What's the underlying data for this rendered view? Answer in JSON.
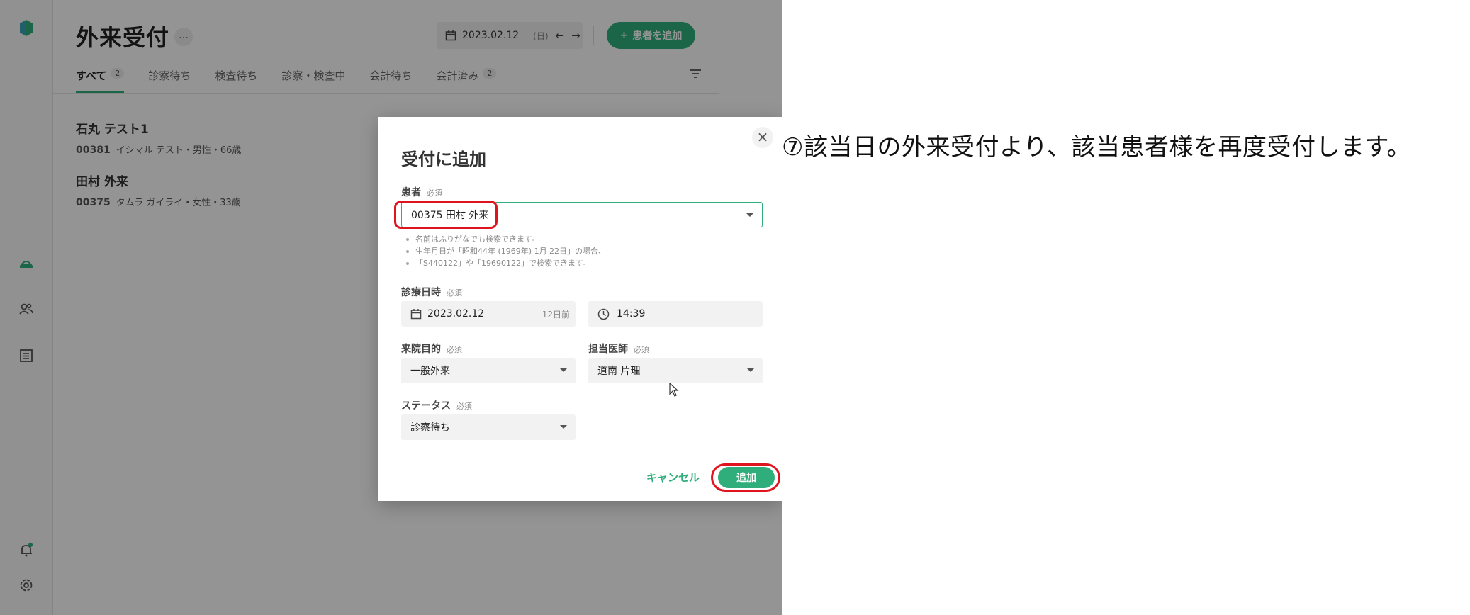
{
  "header": {
    "title": "外来受付",
    "more": "…",
    "date": "2023.02.12",
    "day_of_week": "(日)",
    "add_patient_label": "患者を追加"
  },
  "tabs": [
    {
      "label": "すべて",
      "badge": "2"
    },
    {
      "label": "診察待ち",
      "badge": ""
    },
    {
      "label": "検査待ち",
      "badge": ""
    },
    {
      "label": "診察・検査中",
      "badge": ""
    },
    {
      "label": "会計待ち",
      "badge": ""
    },
    {
      "label": "会計済み",
      "badge": "2"
    }
  ],
  "patients": [
    {
      "name": "石丸 テスト1",
      "id": "00381",
      "details": "イシマル テスト・男性・66歳"
    },
    {
      "name": "田村 外来",
      "id": "00375",
      "details": "タムラ ガイライ・女性・33歳"
    }
  ],
  "dialog": {
    "title": "受付に追加",
    "close": "×",
    "required": "必須",
    "patient_label": "患者",
    "patient_value": "00375 田村 外来",
    "hint1": "名前はふりがなでも検索できます。",
    "hint2": "生年月日が「昭和44年 (1969年) 1月 22日」の場合、",
    "hint3": "「S440122」や「19690122」で検索できます。",
    "datetime_label": "診療日時",
    "date_value": "2023.02.12",
    "date_relative": "12日前",
    "time_value": "14:39",
    "purpose_label": "来院目的",
    "purpose_value": "一般外来",
    "doctor_label": "担当医師",
    "doctor_value": "道南 片理",
    "status_label": "ステータス",
    "status_value": "診察待ち",
    "cancel_label": "キャンセル",
    "submit_label": "追加"
  },
  "annotation": {
    "text": "⑦該当日の外来受付より、該当患者様を再度受付します。"
  },
  "colors": {
    "accent": "#2fae7c",
    "highlight": "#e0141e"
  }
}
